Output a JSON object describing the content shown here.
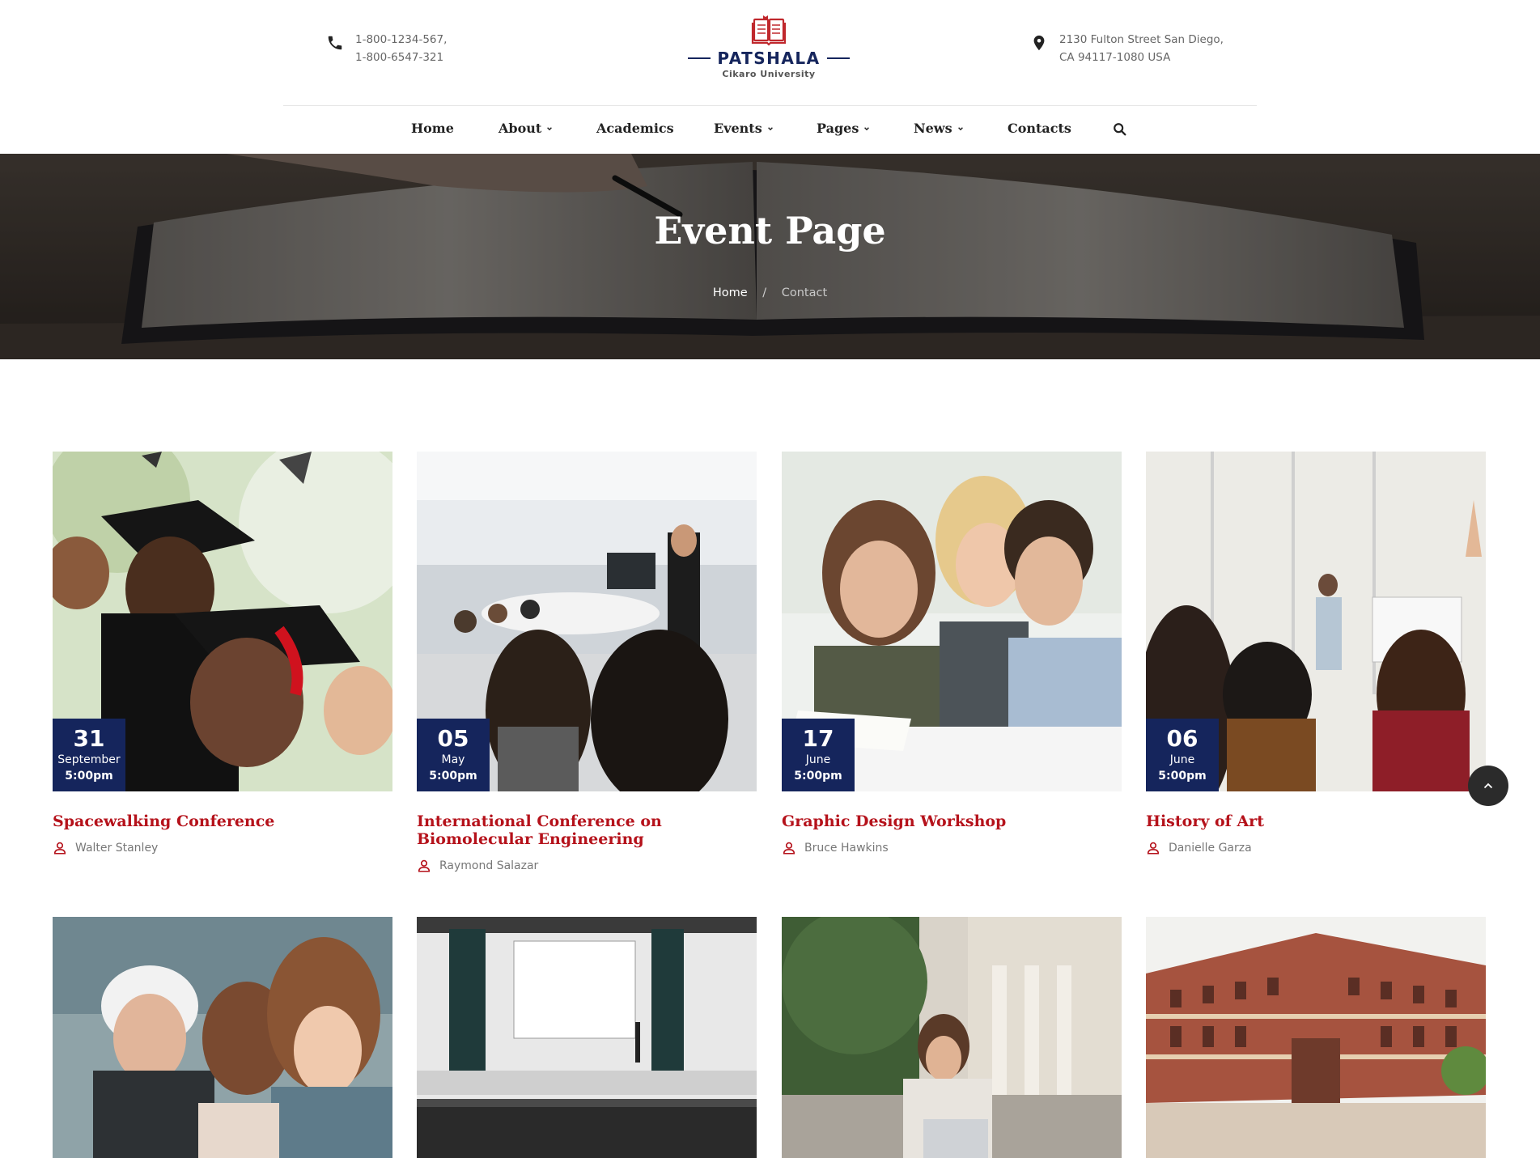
{
  "header": {
    "phone_lines": [
      "1-800-1234-567,",
      "1-800-6547-321"
    ],
    "address_lines": [
      "2130 Fulton Street San Diego,",
      "CA 94117-1080 USA"
    ],
    "logo_name": "PATSHALA",
    "logo_sub": "Cikaro University",
    "icons": {
      "phone": "phone-icon",
      "location": "map-pin-icon",
      "logo": "open-book-icon"
    }
  },
  "nav": {
    "items": [
      {
        "label": "Home",
        "has_dropdown": false
      },
      {
        "label": "About",
        "has_dropdown": true
      },
      {
        "label": "Academics",
        "has_dropdown": false
      },
      {
        "label": "Events",
        "has_dropdown": true
      },
      {
        "label": "Pages",
        "has_dropdown": true
      },
      {
        "label": "News",
        "has_dropdown": true
      },
      {
        "label": "Contacts",
        "has_dropdown": false
      }
    ],
    "search_icon": "search-icon"
  },
  "hero": {
    "title": "Event Page",
    "breadcrumb": {
      "home": "Home",
      "separator": "/",
      "current": "Contact"
    }
  },
  "events": [
    {
      "day": "31",
      "month": "September",
      "time": "5:00pm",
      "title": "Spacewalking Conference",
      "author": "Walter Stanley"
    },
    {
      "day": "05",
      "month": "May",
      "time": "5:00pm",
      "title": "International Conference on Biomolecular Engineering",
      "author": "Raymond Salazar"
    },
    {
      "day": "17",
      "month": "June",
      "time": "5:00pm",
      "title": "Graphic Design Workshop",
      "author": "Bruce Hawkins"
    },
    {
      "day": "06",
      "month": "June",
      "time": "5:00pm",
      "title": "History of Art",
      "author": "Danielle Garza"
    }
  ],
  "colors": {
    "primary_navy": "#15255c",
    "accent_red": "#b5121b",
    "text_gray": "#777777"
  },
  "scroll_top_icon": "chevron-up-icon"
}
